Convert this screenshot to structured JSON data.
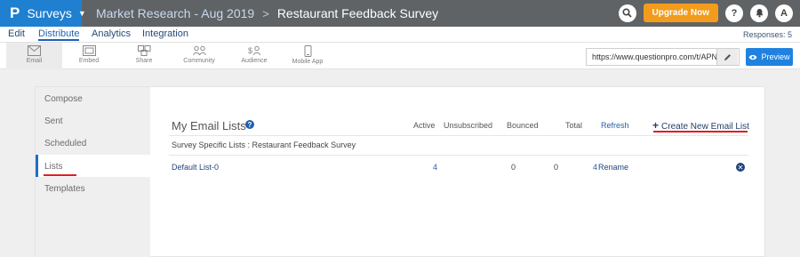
{
  "topbar": {
    "brand": "Surveys",
    "breadcrumb_parent": "Market Research - Aug 2019",
    "breadcrumb_sep": ">",
    "survey_title": "Restaurant Feedback Survey",
    "upgrade_label": "Upgrade Now",
    "help_glyph": "?",
    "avatar_letter": "A",
    "colors": {
      "bar": "#5f6366",
      "brand": "#1f7fd0",
      "upgrade": "#f39b1c"
    }
  },
  "menubar": {
    "items": [
      "Edit",
      "Distribute",
      "Analytics",
      "Integration"
    ],
    "active": "Distribute",
    "responses": "Responses: 5"
  },
  "toolbar": {
    "tools": [
      {
        "label": "Email",
        "icon": "envelope-icon"
      },
      {
        "label": "Embed",
        "icon": "embed-icon"
      },
      {
        "label": "Share",
        "icon": "share-icon"
      },
      {
        "label": "Community",
        "icon": "community-icon"
      },
      {
        "label": "Audience",
        "icon": "audience-icon"
      },
      {
        "label": "Mobile App",
        "icon": "mobile-icon"
      }
    ],
    "active_tool": "Email",
    "url_value": "https://www.questionpro.com/t/APNrFZ",
    "preview_label": "Preview"
  },
  "sidenav": {
    "items": [
      "Compose",
      "Sent",
      "Scheduled",
      "Lists",
      "Templates"
    ],
    "active": "Lists"
  },
  "email_lists": {
    "title": "My Email Lists",
    "help_glyph": "?",
    "columns": [
      "Active",
      "Unsubscribed",
      "Bounced",
      "Total"
    ],
    "refresh_label": "Refresh",
    "create_label": "Create New Email List",
    "subheading": "Survey Specific Lists : Restaurant Feedback Survey",
    "rows": [
      {
        "name": "Default List-0",
        "active": "4",
        "unsubscribed": "0",
        "bounced": "0",
        "total": "4",
        "rename_label": "Rename"
      }
    ]
  }
}
